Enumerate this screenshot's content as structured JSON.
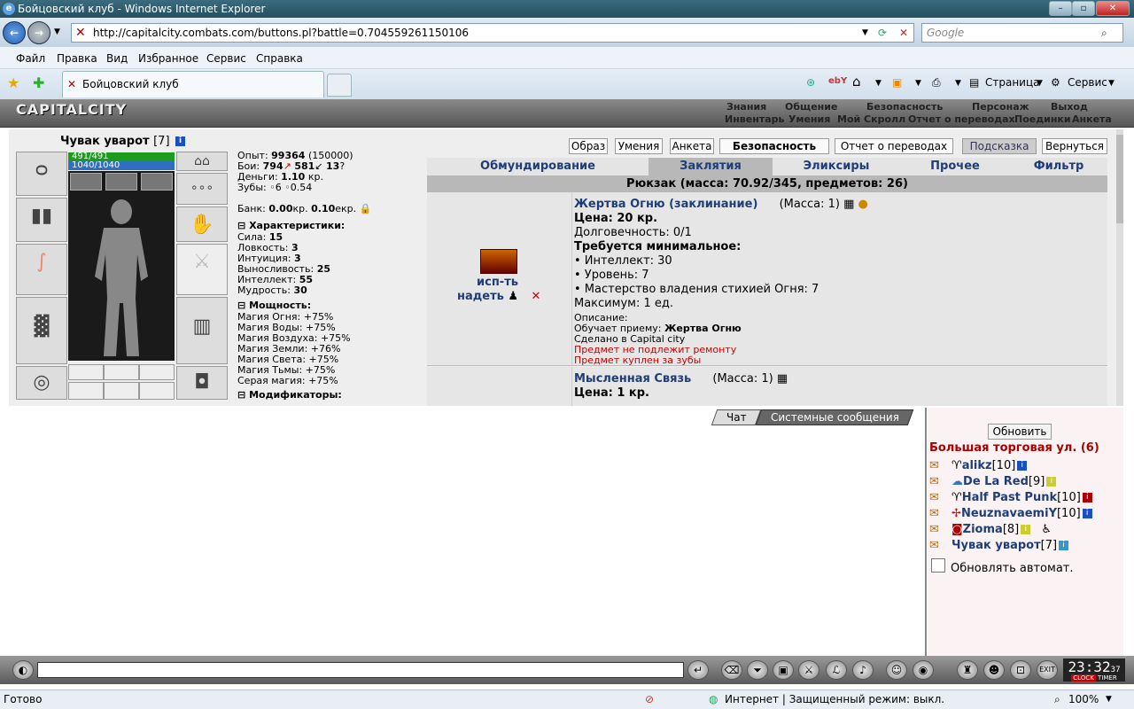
{
  "window": {
    "title": "Бойцовский клуб - Windows Internet Explorer"
  },
  "address": {
    "url": "http://capitalcity.combats.com/buttons.pl?battle=0.704559261150106",
    "search_placeholder": "Google"
  },
  "menu": [
    "Файл",
    "Правка",
    "Вид",
    "Избранное",
    "Сервис",
    "Справка"
  ],
  "tab": {
    "label": "Бойцовский клуб"
  },
  "command_bar": {
    "page": "Страница",
    "tools": "Сервис"
  },
  "game": {
    "logo": "CAPITALCITY",
    "nav_top": [
      "Знания",
      "Общение",
      "Безопасность",
      "Персонаж",
      "Выход"
    ],
    "nav_bottom": [
      "Инвентарь",
      "Умения",
      "Мой Скролл",
      "Отчет о переводах",
      "Поединки",
      "Анкета"
    ]
  },
  "character": {
    "name": "Чувак уварот",
    "level": "[7]",
    "hp": "491/491",
    "mana": "1040/1040",
    "exp_label": "Опыт:",
    "exp": "99364",
    "exp_next": "(150000)",
    "fights_label": "Бои:",
    "wins": "794",
    "losses": "581",
    "draws": "13",
    "money_label": "Деньги:",
    "money": "1.10",
    "money_unit": "кр.",
    "teeth_label": "Зубы:",
    "teeth": "6",
    "teeth2": "0.54",
    "bank_label": "Банк:",
    "bank_kr": "0.00",
    "bank_kr_unit": "кр.",
    "bank_ekr": "0.10",
    "bank_ekr_unit": "екр.",
    "stats_title": "Характеристики:",
    "stats": [
      {
        "k": "Сила:",
        "v": "15"
      },
      {
        "k": "Ловкость:",
        "v": "3"
      },
      {
        "k": "Интуиция:",
        "v": "3"
      },
      {
        "k": "Выносливость:",
        "v": "25"
      },
      {
        "k": "Интеллект:",
        "v": "55"
      },
      {
        "k": "Мудрость:",
        "v": "30"
      }
    ],
    "power_title": "Мощность:",
    "powers": [
      "Магия Огня: +75%",
      "Магия Воды: +75%",
      "Магия Воздуха: +75%",
      "Магия Земли: +76%",
      "Магия Света: +75%",
      "Магия Тьмы: +75%",
      "Серая магия: +75%"
    ],
    "mods_title": "Модификаторы:"
  },
  "inventory": {
    "top_buttons": [
      "Образ",
      "Умения",
      "Анкета",
      "Безопасность",
      "Отчет о переводах",
      "Подсказка",
      "Вернуться"
    ],
    "categories": [
      "Обмундирование",
      "Заклятия",
      "Эликсиры",
      "Прочее",
      "Фильтр"
    ],
    "backpack": "Рюкзак (масса: 70.92/345, предметов: 26)",
    "items": [
      {
        "use_link": "исп-ть",
        "equip_link": "надеть",
        "title": "Жертва Огню (заклинание)",
        "mass": "(Масса: 1)",
        "price": "Цена: 20 кр.",
        "durability": "Долговечность: 0/1",
        "req_title": "Требуется минимальное:",
        "reqs": [
          "• Интеллект: 30",
          "• Уровень: 7",
          "• Мастерство владения стихией Огня: 7"
        ],
        "max": "Максимум: 1 ед.",
        "desc_label": "Описание:",
        "teaches_prefix": "Обучает приему:",
        "teaches": "Жертва Огню",
        "made": "Сделано в Capital city",
        "warn1": "Предмет не подлежит ремонту",
        "warn2": "Предмет куплен за зубы"
      },
      {
        "title": "Мысленная Связь",
        "mass": "(Масса: 1)",
        "price": "Цена: 1 кр."
      }
    ]
  },
  "chat": {
    "tab_chat": "Чат",
    "tab_system": "Системные сообщения"
  },
  "users": {
    "refresh": "Обновить",
    "location": "Большая торговая ул. (6)",
    "list": [
      {
        "name": "alikz",
        "level": "[10]"
      },
      {
        "name": "De La Red",
        "level": "[9]"
      },
      {
        "name": "Half Past Punk",
        "level": "[10]"
      },
      {
        "name": "NeuznavaemiY",
        "level": "[10]"
      },
      {
        "name": "Zioma",
        "level": "[8]"
      },
      {
        "name": "Чувак уварот",
        "level": "[7]"
      }
    ],
    "auto_refresh": "Обновлять автомат."
  },
  "toolbar": {
    "time": "23:32",
    "seconds": "37",
    "clock": "CLOCK",
    "timer": "TIMER",
    "exit": "EXIT"
  },
  "status": {
    "ready": "Готово",
    "zone": "Интернет | Защищенный режим: выкл.",
    "zoom": "100%"
  }
}
